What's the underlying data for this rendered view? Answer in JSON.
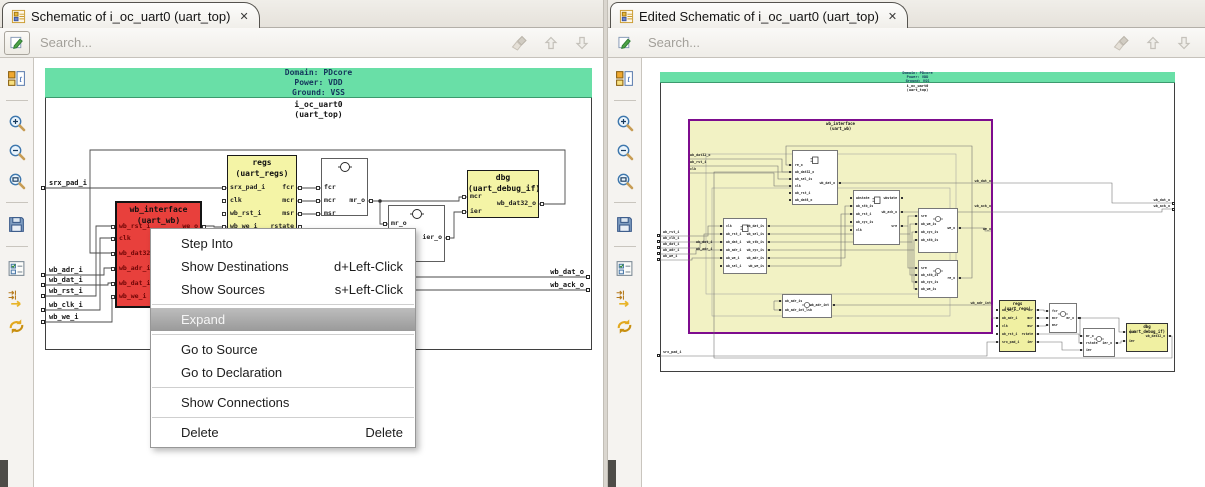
{
  "panels": [
    {
      "tab": {
        "title": "Schematic of i_oc_uart0 (uart_top)",
        "close": "✕"
      },
      "toolbar": {
        "search_placeholder": "Search..."
      }
    },
    {
      "tab": {
        "title": "Edited Schematic of i_oc_uart0 (uart_top)",
        "close": "✕"
      },
      "toolbar": {
        "search_placeholder": "Search..."
      }
    }
  ],
  "sidebar_icons": [
    "instance-info",
    "zoom-in",
    "zoom-out",
    "zoom-fit",
    "save",
    "filter-options",
    "trace-signals",
    "refresh"
  ],
  "toolbar_icons": [
    "clear",
    "previous",
    "next"
  ],
  "context_menu": {
    "items": [
      {
        "label": "Step Into",
        "accel": ""
      },
      {
        "label": "Show Destinations",
        "accel": "d+Left-Click"
      },
      {
        "label": "Show Sources",
        "accel": "s+Left-Click"
      },
      {
        "label": "Expand",
        "accel": ""
      },
      {
        "label": "Go to Source",
        "accel": ""
      },
      {
        "label": "Go to Declaration",
        "accel": ""
      },
      {
        "label": "Show Connections",
        "accel": ""
      },
      {
        "label": "Delete",
        "accel": "Delete"
      }
    ]
  },
  "colors": {
    "domain_header": "#69DFA7",
    "block_yellow": "#F4F4A6",
    "block_red": "#E8403C",
    "container_border_purple": "#7D0C8E"
  },
  "schematics": [
    {
      "header": {
        "domain": "Domain: PDcore",
        "power": "Power: VDD",
        "ground": "Ground: VSS",
        "instance": "i_oc_uart0",
        "module": "(uart_top)"
      },
      "blocks": {
        "regs": {
          "title": "regs",
          "subtitle": "(uart_regs)",
          "left": [
            "srx_pad_i",
            "clk",
            "wb_rst_i",
            "wb_we_i"
          ],
          "right": [
            "fcr",
            "mcr",
            "msr",
            "rstate"
          ]
        },
        "gate1": {
          "left": [
            "fcr",
            "mcr",
            "msr"
          ],
          "right": [
            "mr_o"
          ]
        },
        "gate2": {
          "left": [
            "mr_o"
          ],
          "right": [
            "ier_o"
          ]
        },
        "dbg": {
          "title": "dbg",
          "subtitle": "(uart_debug_if)",
          "left": [
            "mcr",
            "ier"
          ],
          "right": [
            "wb_dat32_o"
          ]
        },
        "wb": {
          "title": "wb_interface",
          "subtitle": "(uart_wb)",
          "left": [
            "wb_rst_i",
            "clk",
            "wb_dat32_o",
            "wb_adr_i",
            "wb_dat_i",
            "wb_we_i"
          ],
          "right": [
            "we_o"
          ]
        }
      },
      "pins_left": [
        "srx_pad_i",
        "wb_adr_i",
        "wb_dat_i",
        "wb_rst_i",
        "wb_clk_i",
        "wb_we_i"
      ],
      "pins_right": [
        "wb_dat_o",
        "wb_ack_o"
      ],
      "labels": []
    },
    {
      "header": {
        "domain": "Domain: PDcore",
        "power": "Power: VDD",
        "ground": "Ground: VSS",
        "instance": "i_oc_uart0",
        "module": "(uart_top)"
      },
      "container": {
        "title": "wb_interface",
        "subtitle": "(uart_wb)"
      },
      "blocks": {
        "a": {
          "left": [
            "re_o",
            "wb_dat32_o",
            "wb_sel_is",
            "clk",
            "wb_rst_i",
            "wb_dat8_o"
          ],
          "right": [
            "wb_dat_o"
          ]
        },
        "b": {
          "left": [
            "wbstate",
            "wb_stb_is",
            "wb_rst_i",
            "wb_cyc_is",
            "clk"
          ],
          "right": [
            "wbstate",
            "wb_ack_o",
            "sre"
          ]
        },
        "c": {
          "left": [
            "clk",
            "wb_rst_i",
            "wb_dat_i",
            "wb_adr_i",
            "wb_we_i",
            "wb_sel_i"
          ],
          "right": [
            "wb_dat_is",
            "wb_sel_is",
            "wb_stb_is",
            "wb_cyc_is",
            "wb_adr_is",
            "wb_we_is"
          ]
        },
        "d": {
          "left": [
            "sre",
            "wb_we_is",
            "wb_cyc_is",
            "wb_stb_is"
          ],
          "right": [
            "we_o"
          ]
        },
        "e": {
          "left": [
            "sre",
            "wb_stb_is",
            "wb_cyc_is",
            "wb_we_is"
          ],
          "right": [
            "re_o"
          ]
        },
        "f": {
          "left": [
            "wb_adr_is",
            "wb_adr_int_lsb"
          ],
          "right": [
            "wb_adr_int"
          ]
        },
        "regs2": {
          "title": "regs",
          "subtitle": "(uart_regs)",
          "left": [
            "wb_we_i",
            "wb_adr_i",
            "clk",
            "wb_rst_i",
            "srx_pad_i"
          ],
          "right": [
            "fcr",
            "mcr",
            "msr",
            "rstate",
            "ier"
          ]
        },
        "gs1": {
          "left": [
            "fcr",
            "mcr",
            "msr"
          ],
          "right": [
            "mr_o"
          ]
        },
        "gs2": {
          "left": [
            "mr_o",
            "rstate",
            "ier"
          ],
          "right": [
            "ier_o"
          ]
        },
        "dbg2": {
          "title": "dbg",
          "subtitle": "(uart_debug_if)",
          "left": [
            "mcr",
            "ier"
          ],
          "right": [
            "wb_dat32_o"
          ]
        }
      },
      "pins_left": [
        "wb_rst_i",
        "wb_clk_i",
        "wb_dat_i",
        "wb_adr_i",
        "wb_we_i",
        "srx_pad_i"
      ],
      "pins_right": [
        "wb_dat_o",
        "wb_ack_o"
      ],
      "labels": [
        "wb_dat_o",
        "wb_ack_o",
        "we_o",
        "wb_adr_int",
        "wb_dat_i",
        "wb_adr_i",
        "wb_dat32_o",
        "wb_rst_i",
        "clk"
      ]
    }
  ]
}
